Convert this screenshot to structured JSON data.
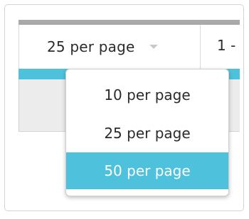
{
  "pagination": {
    "selected_label": "25 per page",
    "range_text": "1 -"
  },
  "dropdown": {
    "options": [
      {
        "label": "10 per page",
        "selected": false
      },
      {
        "label": "25 per page",
        "selected": false
      },
      {
        "label": "50 per page",
        "selected": true
      }
    ]
  },
  "colors": {
    "accent": "#4ec2dd",
    "header_bar": "#a9a9a9",
    "row_gray": "#ececec"
  },
  "icons": {
    "select_caret": "chevron-down-icon"
  }
}
